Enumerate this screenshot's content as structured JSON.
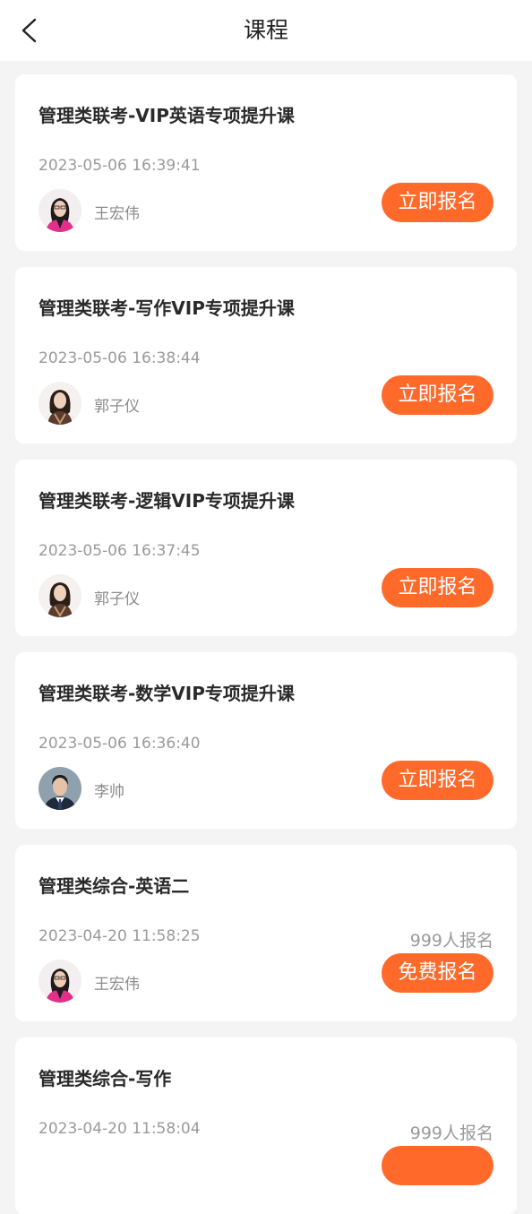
{
  "header": {
    "title": "课程"
  },
  "courses": [
    {
      "title": "管理类联考-VIP英语专项提升课",
      "time": "2023-05-06 16:39:41",
      "teacher": "王宏伟",
      "button": "立即报名",
      "count": ""
    },
    {
      "title": "管理类联考-写作VIP专项提升课",
      "time": "2023-05-06 16:38:44",
      "teacher": "郭子仪",
      "button": "立即报名",
      "count": ""
    },
    {
      "title": "管理类联考-逻辑VIP专项提升课",
      "time": "2023-05-06 16:37:45",
      "teacher": "郭子仪",
      "button": "立即报名",
      "count": ""
    },
    {
      "title": "管理类联考-数学VIP专项提升课",
      "time": "2023-05-06 16:36:40",
      "teacher": "李帅",
      "button": "立即报名",
      "count": ""
    },
    {
      "title": "管理类综合-英语二",
      "time": "2023-04-20 11:58:25",
      "teacher": "王宏伟",
      "button": "免费报名",
      "count": "999人报名"
    },
    {
      "title": "管理类综合-写作",
      "time": "2023-04-20 11:58:04",
      "teacher": "",
      "button": "",
      "count": "999人报名"
    }
  ],
  "colors": {
    "accent": "#ff6a2b",
    "background": "#f4f4f4"
  },
  "icons": {
    "back": "chevron-left-icon"
  }
}
